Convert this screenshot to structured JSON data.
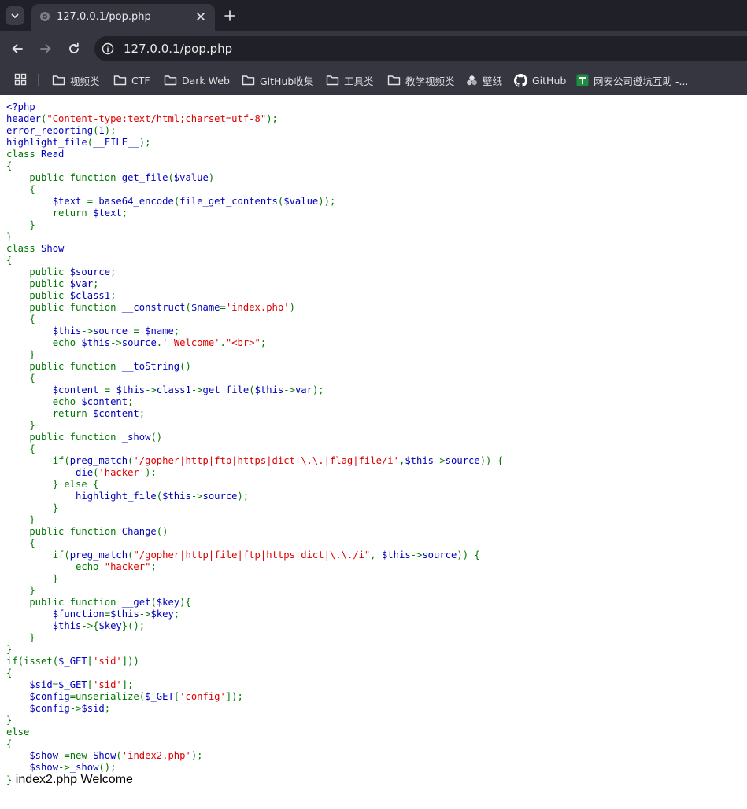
{
  "browser": {
    "tab_title": "127.0.0.1/pop.php",
    "url": "127.0.0.1/pop.php",
    "bookmarks": [
      {
        "label": "视频类",
        "icon": "folder-icon"
      },
      {
        "label": "CTF",
        "icon": "folder-icon"
      },
      {
        "label": "Dark Web",
        "icon": "folder-icon"
      },
      {
        "label": "GitHub收集",
        "icon": "folder-icon"
      },
      {
        "label": "工具类",
        "icon": "folder-icon"
      },
      {
        "label": "教学视频类",
        "icon": "folder-icon"
      },
      {
        "label": "壁纸",
        "icon": "wallpaper-icon"
      },
      {
        "label": "GitHub",
        "icon": "github-icon"
      },
      {
        "label": "网安公司遵坑互助 -...",
        "icon": "spreadsheet-icon"
      }
    ]
  },
  "source_code": [
    [
      [
        "b",
        "<?php"
      ]
    ],
    [
      [
        "b",
        "header"
      ],
      [
        "g",
        "("
      ],
      [
        "r",
        "\"Content-type:text/html;charset=utf-8\""
      ],
      [
        "g",
        ");"
      ]
    ],
    [
      [
        "b",
        "error_reporting"
      ],
      [
        "g",
        "("
      ],
      [
        "b",
        "1"
      ],
      [
        "g",
        ");"
      ]
    ],
    [
      [
        "b",
        "highlight_file"
      ],
      [
        "g",
        "("
      ],
      [
        "b",
        "__FILE__"
      ],
      [
        "g",
        ");"
      ]
    ],
    [
      [
        "g",
        "class "
      ],
      [
        "b",
        "Read"
      ]
    ],
    [
      [
        "g",
        "{"
      ]
    ],
    [
      [
        "g",
        "    public function "
      ],
      [
        "b",
        "get_file"
      ],
      [
        "g",
        "("
      ],
      [
        "b",
        "$value"
      ],
      [
        "g",
        ")"
      ]
    ],
    [
      [
        "g",
        "    {"
      ]
    ],
    [
      [
        "b",
        "        $text "
      ],
      [
        "g",
        "= "
      ],
      [
        "b",
        "base64_encode"
      ],
      [
        "g",
        "("
      ],
      [
        "b",
        "file_get_contents"
      ],
      [
        "g",
        "("
      ],
      [
        "b",
        "$value"
      ],
      [
        "g",
        "));"
      ]
    ],
    [
      [
        "g",
        "        return "
      ],
      [
        "b",
        "$text"
      ],
      [
        "g",
        ";"
      ]
    ],
    [
      [
        "g",
        "    }"
      ]
    ],
    [
      [
        "g",
        "}"
      ]
    ],
    [
      [
        "g",
        "class "
      ],
      [
        "b",
        "Show"
      ]
    ],
    [
      [
        "g",
        "{"
      ]
    ],
    [
      [
        "g",
        "    public "
      ],
      [
        "b",
        "$source"
      ],
      [
        "g",
        ";"
      ]
    ],
    [
      [
        "g",
        "    public "
      ],
      [
        "b",
        "$var"
      ],
      [
        "g",
        ";"
      ]
    ],
    [
      [
        "g",
        "    public "
      ],
      [
        "b",
        "$class1"
      ],
      [
        "g",
        ";"
      ]
    ],
    [
      [
        "g",
        "    public function "
      ],
      [
        "b",
        "__construct"
      ],
      [
        "g",
        "("
      ],
      [
        "b",
        "$name"
      ],
      [
        "g",
        "="
      ],
      [
        "r",
        "'index.php'"
      ],
      [
        "g",
        ")"
      ]
    ],
    [
      [
        "g",
        "    {"
      ]
    ],
    [
      [
        "b",
        "        $this"
      ],
      [
        "g",
        "->"
      ],
      [
        "b",
        "source "
      ],
      [
        "g",
        "= "
      ],
      [
        "b",
        "$name"
      ],
      [
        "g",
        ";"
      ]
    ],
    [
      [
        "g",
        "        echo "
      ],
      [
        "b",
        "$this"
      ],
      [
        "g",
        "->"
      ],
      [
        "b",
        "source"
      ],
      [
        "g",
        "."
      ],
      [
        "r",
        "' Welcome'"
      ],
      [
        "g",
        "."
      ],
      [
        "r",
        "\"<br>\""
      ],
      [
        "g",
        ";"
      ]
    ],
    [
      [
        "g",
        "    }"
      ]
    ],
    [
      [
        "g",
        "    public function "
      ],
      [
        "b",
        "__toString"
      ],
      [
        "g",
        "()"
      ]
    ],
    [
      [
        "g",
        "    {"
      ]
    ],
    [
      [
        "b",
        "        $content "
      ],
      [
        "g",
        "= "
      ],
      [
        "b",
        "$this"
      ],
      [
        "g",
        "->"
      ],
      [
        "b",
        "class1"
      ],
      [
        "g",
        "->"
      ],
      [
        "b",
        "get_file"
      ],
      [
        "g",
        "("
      ],
      [
        "b",
        "$this"
      ],
      [
        "g",
        "->"
      ],
      [
        "b",
        "var"
      ],
      [
        "g",
        ");"
      ]
    ],
    [
      [
        "g",
        "        echo "
      ],
      [
        "b",
        "$content"
      ],
      [
        "g",
        ";"
      ]
    ],
    [
      [
        "g",
        "        return "
      ],
      [
        "b",
        "$content"
      ],
      [
        "g",
        ";"
      ]
    ],
    [
      [
        "g",
        "    }"
      ]
    ],
    [
      [
        "g",
        "    public function "
      ],
      [
        "b",
        "_show"
      ],
      [
        "g",
        "()"
      ]
    ],
    [
      [
        "g",
        "    {"
      ]
    ],
    [
      [
        "g",
        "        if("
      ],
      [
        "b",
        "preg_match"
      ],
      [
        "g",
        "("
      ],
      [
        "r",
        "'/gopher|http|ftp|https|dict|\\.\\.|flag|file/i'"
      ],
      [
        "g",
        ","
      ],
      [
        "b",
        "$this"
      ],
      [
        "g",
        "->"
      ],
      [
        "b",
        "source"
      ],
      [
        "g",
        ")) {"
      ]
    ],
    [
      [
        "b",
        "            die"
      ],
      [
        "g",
        "("
      ],
      [
        "r",
        "'hacker'"
      ],
      [
        "g",
        ");"
      ]
    ],
    [
      [
        "g",
        "        } else {"
      ]
    ],
    [
      [
        "b",
        "            highlight_file"
      ],
      [
        "g",
        "("
      ],
      [
        "b",
        "$this"
      ],
      [
        "g",
        "->"
      ],
      [
        "b",
        "source"
      ],
      [
        "g",
        ");"
      ]
    ],
    [
      [
        "g",
        "        }"
      ]
    ],
    [
      [
        "g",
        "    }"
      ]
    ],
    [
      [
        "g",
        "    public function "
      ],
      [
        "b",
        "Change"
      ],
      [
        "g",
        "()"
      ]
    ],
    [
      [
        "g",
        "    {"
      ]
    ],
    [
      [
        "g",
        "        if("
      ],
      [
        "b",
        "preg_match"
      ],
      [
        "g",
        "("
      ],
      [
        "r",
        "\"/gopher|http|file|ftp|https|dict|\\.\\./i\""
      ],
      [
        "g",
        ", "
      ],
      [
        "b",
        "$this"
      ],
      [
        "g",
        "->"
      ],
      [
        "b",
        "source"
      ],
      [
        "g",
        ")) {"
      ]
    ],
    [
      [
        "g",
        "            echo "
      ],
      [
        "r",
        "\"hacker\""
      ],
      [
        "g",
        ";"
      ]
    ],
    [
      [
        "g",
        "        }"
      ]
    ],
    [
      [
        "g",
        "    }"
      ]
    ],
    [
      [
        "g",
        "    public function "
      ],
      [
        "b",
        "__get"
      ],
      [
        "g",
        "("
      ],
      [
        "b",
        "$key"
      ],
      [
        "g",
        "){"
      ]
    ],
    [
      [
        "b",
        "        $function"
      ],
      [
        "g",
        "="
      ],
      [
        "b",
        "$this"
      ],
      [
        "g",
        "->"
      ],
      [
        "b",
        "$key"
      ],
      [
        "g",
        ";"
      ]
    ],
    [
      [
        "b",
        "        $this"
      ],
      [
        "g",
        "->{"
      ],
      [
        "b",
        "$key"
      ],
      [
        "g",
        "}();"
      ]
    ],
    [
      [
        "g",
        "    }"
      ]
    ],
    [
      [
        "g",
        "}"
      ]
    ],
    [
      [
        "g",
        "if(isset("
      ],
      [
        "b",
        "$_GET"
      ],
      [
        "g",
        "["
      ],
      [
        "r",
        "'sid'"
      ],
      [
        "g",
        "]))"
      ]
    ],
    [
      [
        "g",
        "{"
      ]
    ],
    [
      [
        "b",
        "    $sid"
      ],
      [
        "g",
        "="
      ],
      [
        "b",
        "$_GET"
      ],
      [
        "g",
        "["
      ],
      [
        "r",
        "'sid'"
      ],
      [
        "g",
        "];"
      ]
    ],
    [
      [
        "b",
        "    $config"
      ],
      [
        "g",
        "=unserialize("
      ],
      [
        "b",
        "$_GET"
      ],
      [
        "g",
        "["
      ],
      [
        "r",
        "'config'"
      ],
      [
        "g",
        "]);"
      ]
    ],
    [
      [
        "b",
        "    $config"
      ],
      [
        "g",
        "->"
      ],
      [
        "b",
        "$sid"
      ],
      [
        "g",
        ";"
      ]
    ],
    [
      [
        "g",
        "}"
      ]
    ],
    [
      [
        "g",
        "else"
      ]
    ],
    [
      [
        "g",
        "{"
      ]
    ],
    [
      [
        "b",
        "    $show "
      ],
      [
        "g",
        "=new "
      ],
      [
        "b",
        "Show"
      ],
      [
        "g",
        "("
      ],
      [
        "r",
        "'index2.php'"
      ],
      [
        "g",
        ");"
      ]
    ],
    [
      [
        "b",
        "    $show"
      ],
      [
        "g",
        "->"
      ],
      [
        "b",
        "_show"
      ],
      [
        "g",
        "();"
      ]
    ]
  ],
  "last_line_code": "}",
  "page_output": "index2.php Welcome",
  "colors": {
    "keyword": "#007700",
    "identifier": "#0000bb",
    "string": "#dd0000",
    "chrome_dark": "#1f2028",
    "chrome": "#35363f"
  }
}
